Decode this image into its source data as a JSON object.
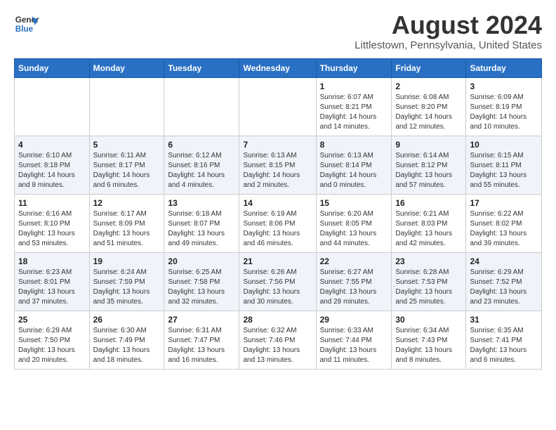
{
  "header": {
    "logo_line1": "General",
    "logo_line2": "Blue",
    "main_title": "August 2024",
    "subtitle": "Littlestown, Pennsylvania, United States"
  },
  "calendar": {
    "columns": [
      "Sunday",
      "Monday",
      "Tuesday",
      "Wednesday",
      "Thursday",
      "Friday",
      "Saturday"
    ],
    "rows": [
      [
        {
          "day": "",
          "info": ""
        },
        {
          "day": "",
          "info": ""
        },
        {
          "day": "",
          "info": ""
        },
        {
          "day": "",
          "info": ""
        },
        {
          "day": "1",
          "info": "Sunrise: 6:07 AM\nSunset: 8:21 PM\nDaylight: 14 hours\nand 14 minutes."
        },
        {
          "day": "2",
          "info": "Sunrise: 6:08 AM\nSunset: 8:20 PM\nDaylight: 14 hours\nand 12 minutes."
        },
        {
          "day": "3",
          "info": "Sunrise: 6:09 AM\nSunset: 8:19 PM\nDaylight: 14 hours\nand 10 minutes."
        }
      ],
      [
        {
          "day": "4",
          "info": "Sunrise: 6:10 AM\nSunset: 8:18 PM\nDaylight: 14 hours\nand 8 minutes."
        },
        {
          "day": "5",
          "info": "Sunrise: 6:11 AM\nSunset: 8:17 PM\nDaylight: 14 hours\nand 6 minutes."
        },
        {
          "day": "6",
          "info": "Sunrise: 6:12 AM\nSunset: 8:16 PM\nDaylight: 14 hours\nand 4 minutes."
        },
        {
          "day": "7",
          "info": "Sunrise: 6:13 AM\nSunset: 8:15 PM\nDaylight: 14 hours\nand 2 minutes."
        },
        {
          "day": "8",
          "info": "Sunrise: 6:13 AM\nSunset: 8:14 PM\nDaylight: 14 hours\nand 0 minutes."
        },
        {
          "day": "9",
          "info": "Sunrise: 6:14 AM\nSunset: 8:12 PM\nDaylight: 13 hours\nand 57 minutes."
        },
        {
          "day": "10",
          "info": "Sunrise: 6:15 AM\nSunset: 8:11 PM\nDaylight: 13 hours\nand 55 minutes."
        }
      ],
      [
        {
          "day": "11",
          "info": "Sunrise: 6:16 AM\nSunset: 8:10 PM\nDaylight: 13 hours\nand 53 minutes."
        },
        {
          "day": "12",
          "info": "Sunrise: 6:17 AM\nSunset: 8:09 PM\nDaylight: 13 hours\nand 51 minutes."
        },
        {
          "day": "13",
          "info": "Sunrise: 6:18 AM\nSunset: 8:07 PM\nDaylight: 13 hours\nand 49 minutes."
        },
        {
          "day": "14",
          "info": "Sunrise: 6:19 AM\nSunset: 8:06 PM\nDaylight: 13 hours\nand 46 minutes."
        },
        {
          "day": "15",
          "info": "Sunrise: 6:20 AM\nSunset: 8:05 PM\nDaylight: 13 hours\nand 44 minutes."
        },
        {
          "day": "16",
          "info": "Sunrise: 6:21 AM\nSunset: 8:03 PM\nDaylight: 13 hours\nand 42 minutes."
        },
        {
          "day": "17",
          "info": "Sunrise: 6:22 AM\nSunset: 8:02 PM\nDaylight: 13 hours\nand 39 minutes."
        }
      ],
      [
        {
          "day": "18",
          "info": "Sunrise: 6:23 AM\nSunset: 8:01 PM\nDaylight: 13 hours\nand 37 minutes."
        },
        {
          "day": "19",
          "info": "Sunrise: 6:24 AM\nSunset: 7:59 PM\nDaylight: 13 hours\nand 35 minutes."
        },
        {
          "day": "20",
          "info": "Sunrise: 6:25 AM\nSunset: 7:58 PM\nDaylight: 13 hours\nand 32 minutes."
        },
        {
          "day": "21",
          "info": "Sunrise: 6:26 AM\nSunset: 7:56 PM\nDaylight: 13 hours\nand 30 minutes."
        },
        {
          "day": "22",
          "info": "Sunrise: 6:27 AM\nSunset: 7:55 PM\nDaylight: 13 hours\nand 28 minutes."
        },
        {
          "day": "23",
          "info": "Sunrise: 6:28 AM\nSunset: 7:53 PM\nDaylight: 13 hours\nand 25 minutes."
        },
        {
          "day": "24",
          "info": "Sunrise: 6:29 AM\nSunset: 7:52 PM\nDaylight: 13 hours\nand 23 minutes."
        }
      ],
      [
        {
          "day": "25",
          "info": "Sunrise: 6:29 AM\nSunset: 7:50 PM\nDaylight: 13 hours\nand 20 minutes."
        },
        {
          "day": "26",
          "info": "Sunrise: 6:30 AM\nSunset: 7:49 PM\nDaylight: 13 hours\nand 18 minutes."
        },
        {
          "day": "27",
          "info": "Sunrise: 6:31 AM\nSunset: 7:47 PM\nDaylight: 13 hours\nand 16 minutes."
        },
        {
          "day": "28",
          "info": "Sunrise: 6:32 AM\nSunset: 7:46 PM\nDaylight: 13 hours\nand 13 minutes."
        },
        {
          "day": "29",
          "info": "Sunrise: 6:33 AM\nSunset: 7:44 PM\nDaylight: 13 hours\nand 11 minutes."
        },
        {
          "day": "30",
          "info": "Sunrise: 6:34 AM\nSunset: 7:43 PM\nDaylight: 13 hours\nand 8 minutes."
        },
        {
          "day": "31",
          "info": "Sunrise: 6:35 AM\nSunset: 7:41 PM\nDaylight: 13 hours\nand 6 minutes."
        }
      ]
    ]
  }
}
